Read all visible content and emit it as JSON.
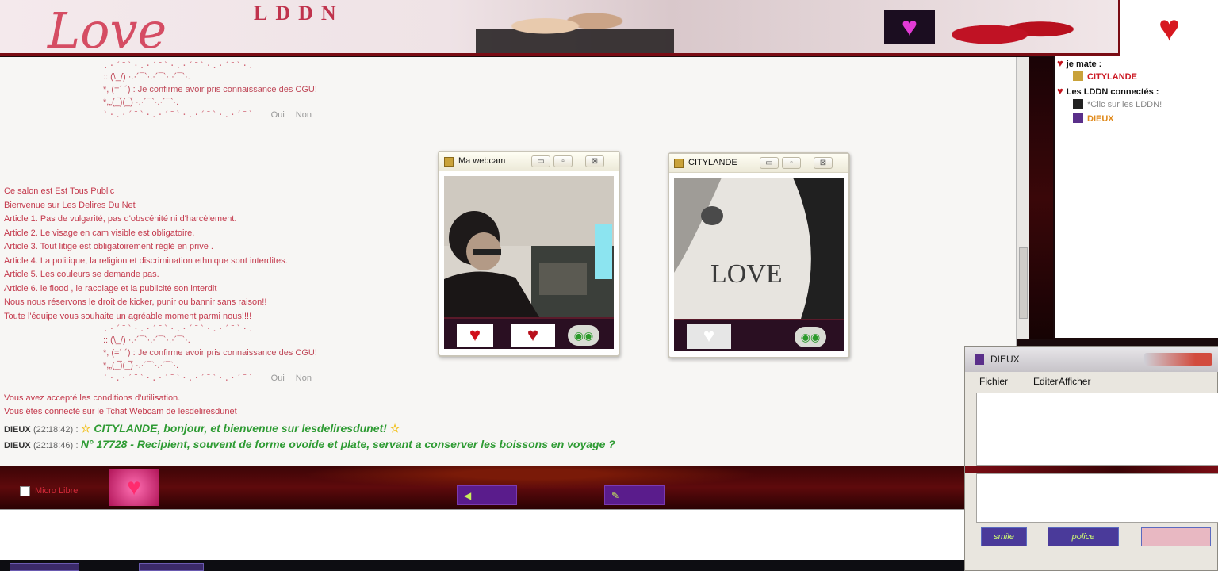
{
  "banner": {
    "brand": "LDDN",
    "logo_word": "Love"
  },
  "cgu_block": {
    "deco_top": ".·´¯`·.·´¯`·.·´¯`·.·´¯`·.",
    "line1": ":: (\\_/) ·.·´¯`·.·´¯`·.·´¯`·.",
    "confirm": "*, (=´ ´) : Je confirme avoir pris connaissance des CGU!",
    "line3": "*,„(_̅)(_̅) ·.·´¯`·.·´¯`·.",
    "deco_bottom": "`·.·´¯`·.·´¯`·.·´¯`·.·´¯`",
    "yes": "Oui",
    "no": "Non"
  },
  "rules": [
    "Ce salon est Est Tous Public",
    "Bienvenue sur Les Delires Du Net",
    "Article 1. Pas de vulgarité, pas d'obscénité ni d'harcèlement.",
    "Article 2. Le visage en cam visible est obligatoire.",
    "Article 3. Tout litige est obligatoirement réglé en prive .",
    "Article 4. La politique, la religion et discrimination ethnique sont interdites.",
    "Article 5.  Les couleurs se demande pas.",
    "Article 6. le flood , le racolage et la publicité son interdit",
    "Nous nous réservons le droit de kicker, punir ou bannir sans raison!!",
    "Toute l'équipe vous souhaite un agréable moment parmi nous!!!!"
  ],
  "accept": [
    "Vous avez accepté les conditions d'utilisation.",
    "Vous êtes connecté sur le Tchat Webcam de lesdeliresdunet"
  ],
  "messages": [
    {
      "user": "DIEUX",
      "time": "(22:18:42)",
      "sep": ":",
      "star1": "☆",
      "text": "CITYLANDE,  bonjour, et bienvenue sur lesdeliresdunet!",
      "star2": "☆"
    },
    {
      "user": "DIEUX",
      "time": "(22:18:46)",
      "sep": ":",
      "text": "N° 17728 - Recipient, souvent de forme ovoide et plate, servant a conserver les boissons en voyage ?"
    }
  ],
  "webcam_own": {
    "title": "Ma webcam"
  },
  "webcam_other": {
    "title": "CITYLANDE",
    "video_text": "LOVE"
  },
  "users": {
    "mate_header": "je mate :",
    "mate_user": "CITYLANDE",
    "lddn_header": "Les LDDN connectés :",
    "lddn_hint": "*Clic sur les LDDN!",
    "lddn_user": "DIEUX"
  },
  "bottom_bar": {
    "checkbox_label": "Micro Libre"
  },
  "private_window": {
    "title": "DIEUX",
    "menu": [
      "Fichier",
      "Editer",
      "Afficher"
    ],
    "buttons": [
      "smile",
      "police",
      ""
    ]
  },
  "colors": {
    "accent": "#7a0c14",
    "rule_text": "#c43a4d",
    "message": "#2e9b33",
    "user_red": "#cc1a24",
    "user_orange": "#e08a1c"
  }
}
